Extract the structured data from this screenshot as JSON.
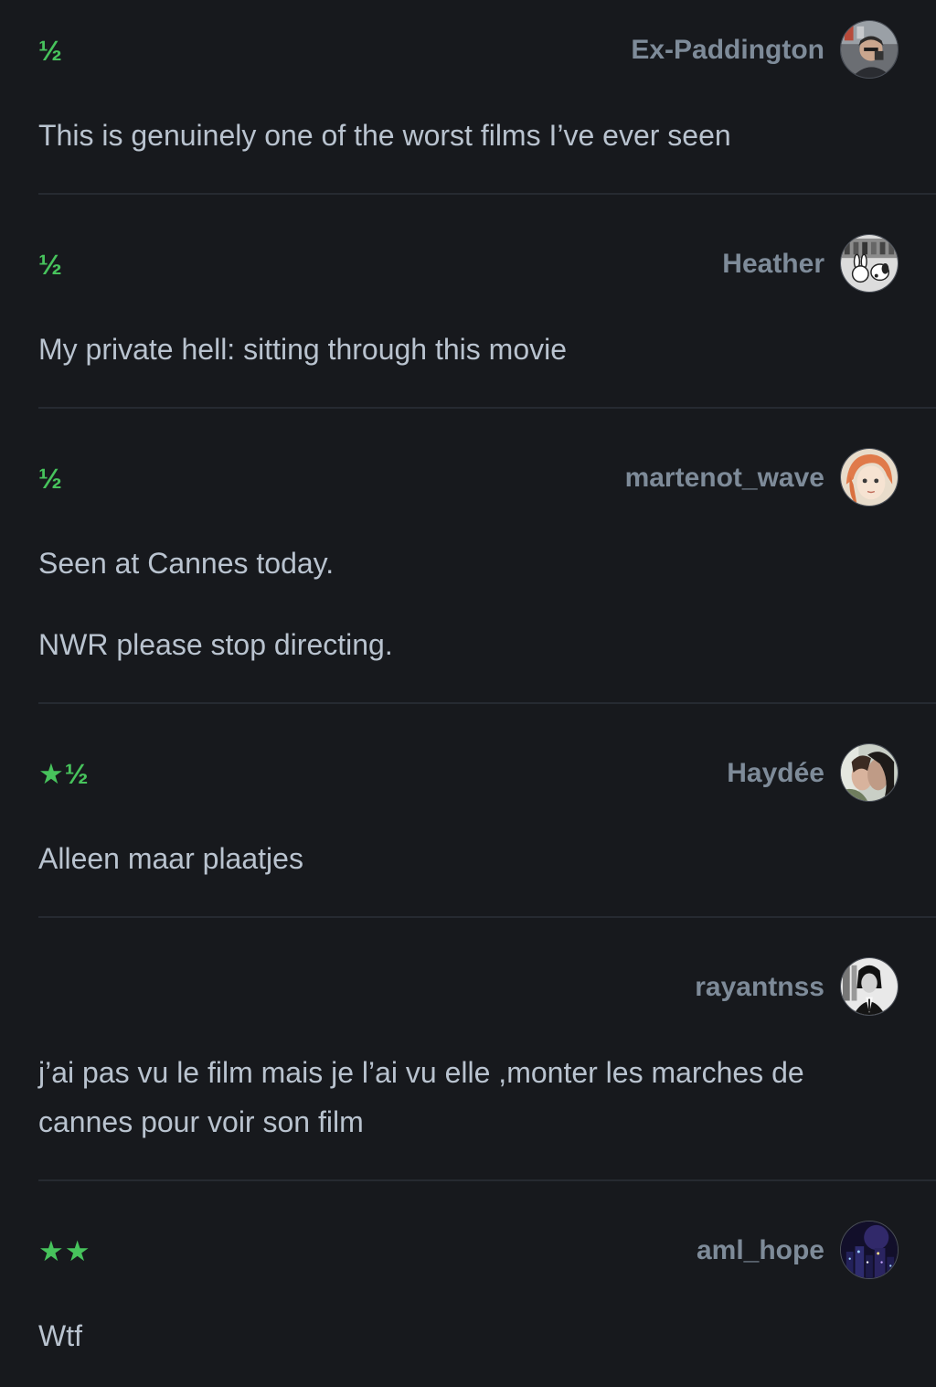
{
  "reviews": [
    {
      "rating": "½",
      "username": "Ex-Paddington",
      "avatar_icon": "avatar-man-portrait-icon",
      "text": [
        "This is genuinely one of the worst films I’ve ever seen"
      ]
    },
    {
      "rating": "½",
      "username": "Heather",
      "avatar_icon": "avatar-bunny-snoopy-icon",
      "text": [
        "My private hell: sitting through this movie"
      ]
    },
    {
      "rating": "½",
      "username": "martenot_wave",
      "avatar_icon": "avatar-anime-girl-icon",
      "text": [
        "Seen at Cannes today.",
        "NWR please stop directing."
      ]
    },
    {
      "rating": "★½",
      "username": "Haydée",
      "avatar_icon": "avatar-kiss-scene-icon",
      "text": [
        "Alleen maar plaatjes"
      ]
    },
    {
      "rating": "",
      "username": "rayantnss",
      "avatar_icon": "avatar-bw-portrait-icon",
      "text": [
        "j’ai pas vu le film mais je l’ai vu elle ,monter les marches de cannes pour voir son film"
      ]
    },
    {
      "rating": "★★",
      "username": "aml_hope",
      "avatar_icon": "avatar-night-city-icon",
      "text": [
        "Wtf"
      ]
    }
  ],
  "colors": {
    "background": "#17191d",
    "rating_green": "#47c35c",
    "username_gray": "#7e8b99",
    "body_text": "#b9c3cf",
    "divider": "#262a31"
  }
}
